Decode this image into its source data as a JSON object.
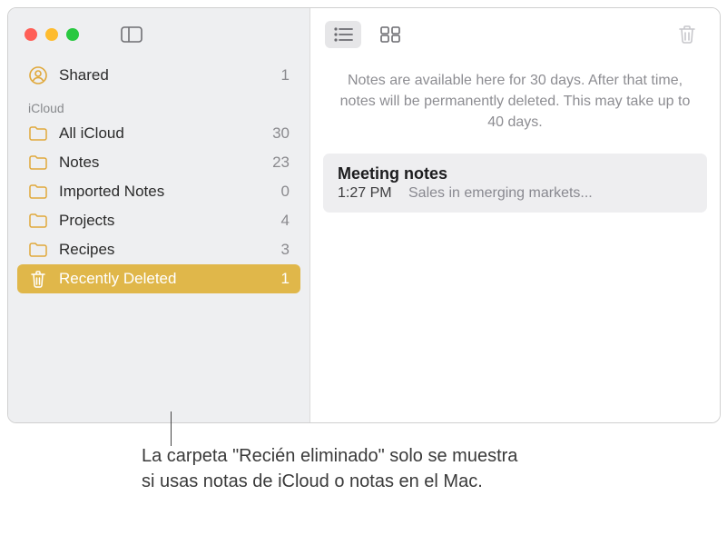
{
  "sidebar": {
    "shared": {
      "label": "Shared",
      "count": "1"
    },
    "section_label": "iCloud",
    "items": [
      {
        "label": "All iCloud",
        "count": "30"
      },
      {
        "label": "Notes",
        "count": "23"
      },
      {
        "label": "Imported Notes",
        "count": "0"
      },
      {
        "label": "Projects",
        "count": "4"
      },
      {
        "label": "Recipes",
        "count": "3"
      }
    ],
    "recently_deleted": {
      "label": "Recently Deleted",
      "count": "1"
    }
  },
  "main": {
    "banner": "Notes are available here for 30 days. After that time, notes will be permanently deleted. This may take up to 40 days.",
    "note": {
      "title": "Meeting notes",
      "time": "1:27 PM",
      "preview": "Sales in emerging markets..."
    }
  },
  "callout": "La carpeta \"Recién eliminado\" solo se muestra si usas notas de iCloud o notas en el Mac."
}
